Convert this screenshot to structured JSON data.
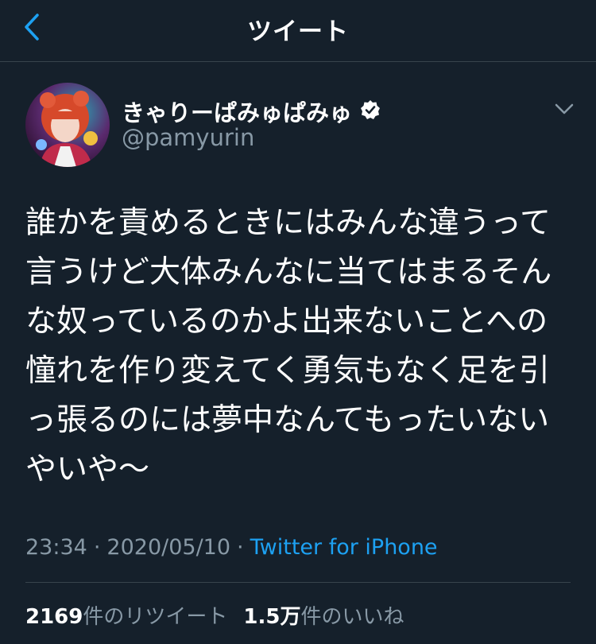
{
  "header": {
    "title": "ツイート",
    "back_icon": "chevron-left-icon",
    "accent_color": "#1da1f2"
  },
  "author": {
    "display_name": "きゃりーぱみゅぱみゅ",
    "handle": "@pamyurin",
    "verified_icon": "verified-badge-icon",
    "avatar_icon": "profile-avatar"
  },
  "tweet": {
    "text": "誰かを責めるときにはみんな違うって言うけど大体みんなに当てはまるそんな奴っているのかよ出来ないことへの憧れを作り変えてく勇気もなく足を引っ張るのには夢中なんてもったいないやいや〜",
    "time": "23:34",
    "date": "2020/05/10",
    "separator": "·",
    "source": "Twitter for iPhone"
  },
  "stats": {
    "retweets_count": "2169",
    "retweets_label": "件のリツイート",
    "likes_count": "1.5万",
    "likes_label": "件のいいね"
  },
  "colors": {
    "background": "#15202b",
    "text": "#ffffff",
    "secondary_text": "#8899a6",
    "link": "#1da1f2",
    "divider": "#38444d"
  }
}
